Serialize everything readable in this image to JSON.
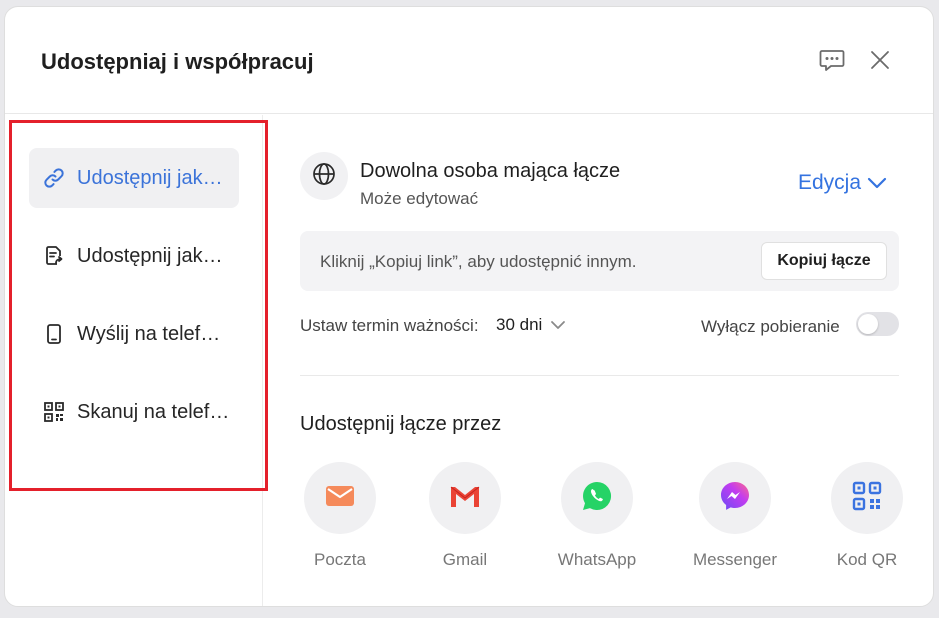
{
  "dialog": {
    "title": "Udostępniaj i współpracuj"
  },
  "sidebar": {
    "items": [
      {
        "label": "Udostępnij jak…",
        "icon": "link-icon",
        "active": true
      },
      {
        "label": "Udostępnij jak…",
        "icon": "file-share-icon",
        "active": false
      },
      {
        "label": "Wyślij na telef…",
        "icon": "phone-icon",
        "active": false
      },
      {
        "label": "Skanuj na telef…",
        "icon": "qr-code-icon",
        "active": false
      }
    ]
  },
  "access": {
    "title": "Dowolna osoba mająca łącze",
    "subtitle": "Może edytować",
    "permission": "Edycja"
  },
  "link": {
    "hint": "Kliknij „Kopiuj link”, aby udostępnić innym.",
    "copy_label": "Kopiuj łącze"
  },
  "expiry": {
    "label": "Ustaw termin ważności:",
    "value": "30 dni"
  },
  "download": {
    "label": "Wyłącz pobieranie",
    "enabled": false
  },
  "share_via": {
    "title": "Udostępnij łącze przez",
    "apps": [
      {
        "label": "Poczta",
        "icon": "mail-icon",
        "color": "#f58a5b"
      },
      {
        "label": "Gmail",
        "icon": "gmail-icon",
        "color": "#ea4335"
      },
      {
        "label": "WhatsApp",
        "icon": "whatsapp-icon",
        "color": "#25d366"
      },
      {
        "label": "Messenger",
        "icon": "messenger-icon",
        "color": "#a845f0"
      },
      {
        "label": "Kod QR",
        "icon": "qr-code-icon",
        "color": "#3b73e0"
      }
    ]
  },
  "colors": {
    "accent": "#3473e0",
    "highlight": "#e4202b"
  }
}
